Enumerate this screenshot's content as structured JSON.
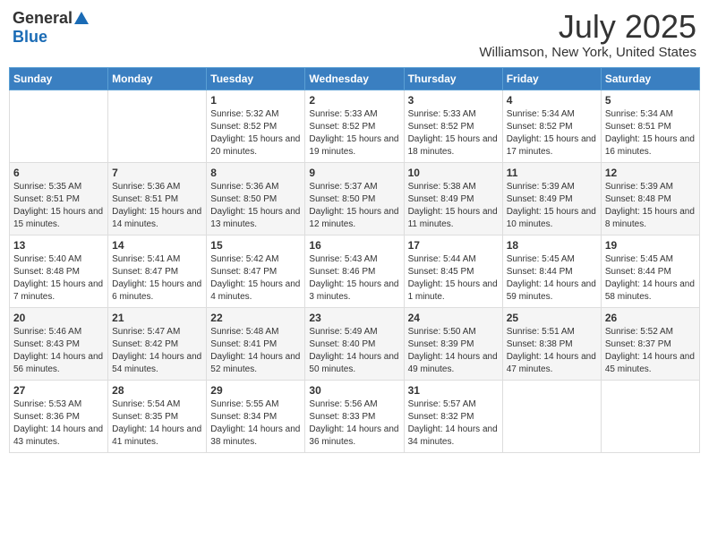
{
  "header": {
    "logo_general": "General",
    "logo_blue": "Blue",
    "month_title": "July 2025",
    "location": "Williamson, New York, United States"
  },
  "weekdays": [
    "Sunday",
    "Monday",
    "Tuesday",
    "Wednesday",
    "Thursday",
    "Friday",
    "Saturday"
  ],
  "weeks": [
    [
      {
        "day": "",
        "info": ""
      },
      {
        "day": "",
        "info": ""
      },
      {
        "day": "1",
        "info": "Sunrise: 5:32 AM\nSunset: 8:52 PM\nDaylight: 15 hours and 20 minutes."
      },
      {
        "day": "2",
        "info": "Sunrise: 5:33 AM\nSunset: 8:52 PM\nDaylight: 15 hours and 19 minutes."
      },
      {
        "day": "3",
        "info": "Sunrise: 5:33 AM\nSunset: 8:52 PM\nDaylight: 15 hours and 18 minutes."
      },
      {
        "day": "4",
        "info": "Sunrise: 5:34 AM\nSunset: 8:52 PM\nDaylight: 15 hours and 17 minutes."
      },
      {
        "day": "5",
        "info": "Sunrise: 5:34 AM\nSunset: 8:51 PM\nDaylight: 15 hours and 16 minutes."
      }
    ],
    [
      {
        "day": "6",
        "info": "Sunrise: 5:35 AM\nSunset: 8:51 PM\nDaylight: 15 hours and 15 minutes."
      },
      {
        "day": "7",
        "info": "Sunrise: 5:36 AM\nSunset: 8:51 PM\nDaylight: 15 hours and 14 minutes."
      },
      {
        "day": "8",
        "info": "Sunrise: 5:36 AM\nSunset: 8:50 PM\nDaylight: 15 hours and 13 minutes."
      },
      {
        "day": "9",
        "info": "Sunrise: 5:37 AM\nSunset: 8:50 PM\nDaylight: 15 hours and 12 minutes."
      },
      {
        "day": "10",
        "info": "Sunrise: 5:38 AM\nSunset: 8:49 PM\nDaylight: 15 hours and 11 minutes."
      },
      {
        "day": "11",
        "info": "Sunrise: 5:39 AM\nSunset: 8:49 PM\nDaylight: 15 hours and 10 minutes."
      },
      {
        "day": "12",
        "info": "Sunrise: 5:39 AM\nSunset: 8:48 PM\nDaylight: 15 hours and 8 minutes."
      }
    ],
    [
      {
        "day": "13",
        "info": "Sunrise: 5:40 AM\nSunset: 8:48 PM\nDaylight: 15 hours and 7 minutes."
      },
      {
        "day": "14",
        "info": "Sunrise: 5:41 AM\nSunset: 8:47 PM\nDaylight: 15 hours and 6 minutes."
      },
      {
        "day": "15",
        "info": "Sunrise: 5:42 AM\nSunset: 8:47 PM\nDaylight: 15 hours and 4 minutes."
      },
      {
        "day": "16",
        "info": "Sunrise: 5:43 AM\nSunset: 8:46 PM\nDaylight: 15 hours and 3 minutes."
      },
      {
        "day": "17",
        "info": "Sunrise: 5:44 AM\nSunset: 8:45 PM\nDaylight: 15 hours and 1 minute."
      },
      {
        "day": "18",
        "info": "Sunrise: 5:45 AM\nSunset: 8:44 PM\nDaylight: 14 hours and 59 minutes."
      },
      {
        "day": "19",
        "info": "Sunrise: 5:45 AM\nSunset: 8:44 PM\nDaylight: 14 hours and 58 minutes."
      }
    ],
    [
      {
        "day": "20",
        "info": "Sunrise: 5:46 AM\nSunset: 8:43 PM\nDaylight: 14 hours and 56 minutes."
      },
      {
        "day": "21",
        "info": "Sunrise: 5:47 AM\nSunset: 8:42 PM\nDaylight: 14 hours and 54 minutes."
      },
      {
        "day": "22",
        "info": "Sunrise: 5:48 AM\nSunset: 8:41 PM\nDaylight: 14 hours and 52 minutes."
      },
      {
        "day": "23",
        "info": "Sunrise: 5:49 AM\nSunset: 8:40 PM\nDaylight: 14 hours and 50 minutes."
      },
      {
        "day": "24",
        "info": "Sunrise: 5:50 AM\nSunset: 8:39 PM\nDaylight: 14 hours and 49 minutes."
      },
      {
        "day": "25",
        "info": "Sunrise: 5:51 AM\nSunset: 8:38 PM\nDaylight: 14 hours and 47 minutes."
      },
      {
        "day": "26",
        "info": "Sunrise: 5:52 AM\nSunset: 8:37 PM\nDaylight: 14 hours and 45 minutes."
      }
    ],
    [
      {
        "day": "27",
        "info": "Sunrise: 5:53 AM\nSunset: 8:36 PM\nDaylight: 14 hours and 43 minutes."
      },
      {
        "day": "28",
        "info": "Sunrise: 5:54 AM\nSunset: 8:35 PM\nDaylight: 14 hours and 41 minutes."
      },
      {
        "day": "29",
        "info": "Sunrise: 5:55 AM\nSunset: 8:34 PM\nDaylight: 14 hours and 38 minutes."
      },
      {
        "day": "30",
        "info": "Sunrise: 5:56 AM\nSunset: 8:33 PM\nDaylight: 14 hours and 36 minutes."
      },
      {
        "day": "31",
        "info": "Sunrise: 5:57 AM\nSunset: 8:32 PM\nDaylight: 14 hours and 34 minutes."
      },
      {
        "day": "",
        "info": ""
      },
      {
        "day": "",
        "info": ""
      }
    ]
  ]
}
